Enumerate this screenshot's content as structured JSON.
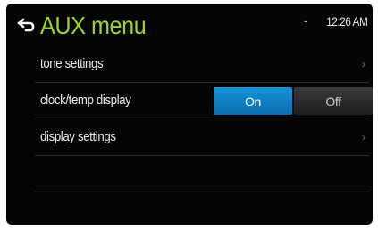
{
  "header": {
    "title": "AUX menu",
    "status_indicator": "-",
    "clock": "12:26 AM",
    "back_icon": "back-arrow-icon"
  },
  "menu": {
    "items": [
      {
        "label": "tone settings",
        "chevron": "›"
      },
      {
        "label": "clock/temp display",
        "toggle": {
          "on_label": "On",
          "off_label": "Off",
          "selected": "On"
        }
      },
      {
        "label": "display settings",
        "chevron": "›"
      },
      {
        "label": ""
      },
      {
        "label": ""
      }
    ]
  },
  "colors": {
    "title": "#9bd42a",
    "accent": "#0f80c4",
    "background": "#050505"
  }
}
